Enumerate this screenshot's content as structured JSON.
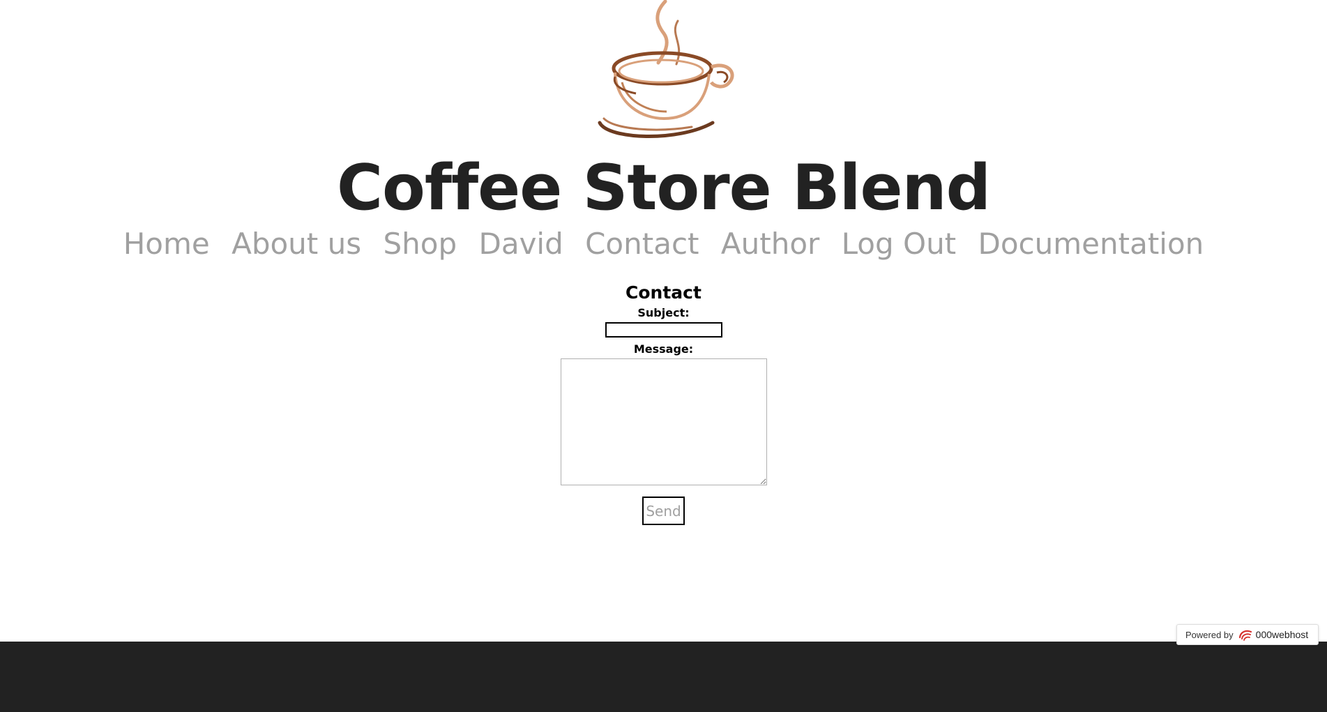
{
  "site": {
    "title": "Coffee Store Blend"
  },
  "nav": {
    "items": [
      {
        "label": "Home"
      },
      {
        "label": "About us"
      },
      {
        "label": "Shop"
      },
      {
        "label": "David"
      },
      {
        "label": "Contact"
      },
      {
        "label": "Author"
      },
      {
        "label": "Log Out"
      },
      {
        "label": "Documentation"
      }
    ]
  },
  "contact_form": {
    "heading": "Contact",
    "subject_label": "Subject:",
    "subject_value": "",
    "message_label": "Message:",
    "message_value": "",
    "send_label": "Send"
  },
  "badge": {
    "prefix": "Powered by",
    "brand": "000webhost",
    "icon": "000webhost-logo-icon"
  },
  "colors": {
    "title": "#222222",
    "nav_link": "#a0a0a0",
    "footer_bg": "#222222",
    "logo_brown_dark": "#6b3a1f",
    "logo_brown_light": "#d9a07a",
    "badge_icon_red": "#d6322f"
  },
  "icons": {
    "logo": "coffee-cup-logo-icon"
  }
}
